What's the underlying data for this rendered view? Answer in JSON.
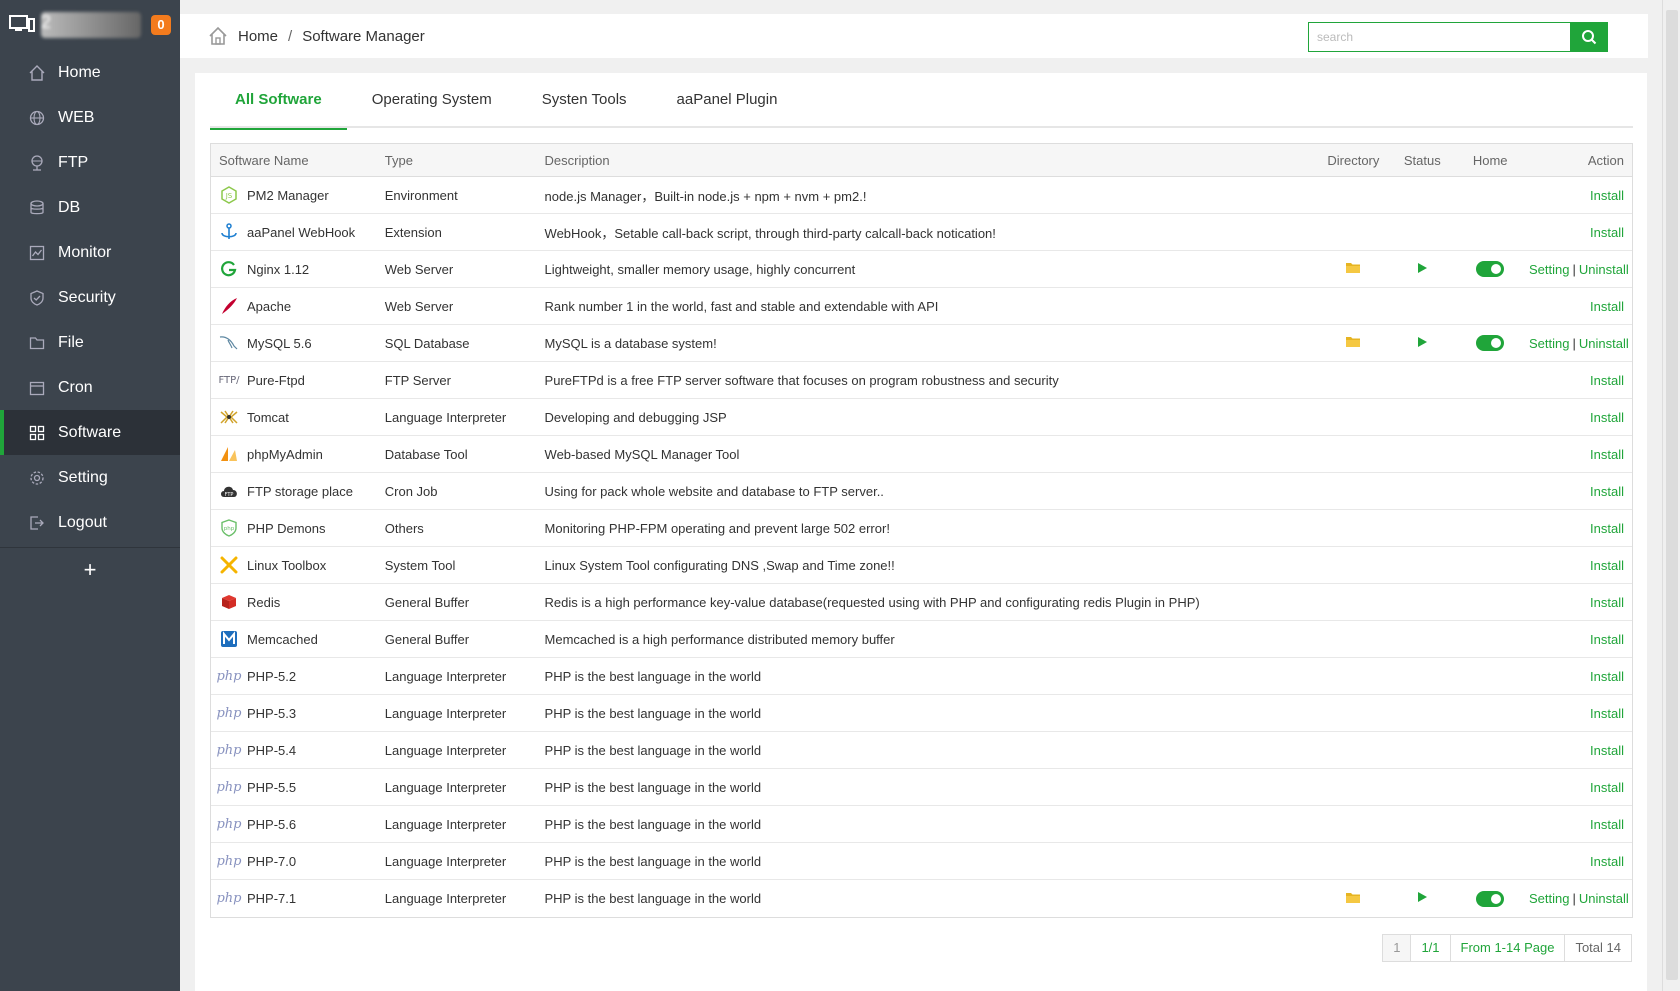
{
  "sidebar": {
    "server_name": "2",
    "notification_count": "0",
    "items": [
      {
        "label": "Home",
        "icon": "home-icon"
      },
      {
        "label": "WEB",
        "icon": "globe-icon"
      },
      {
        "label": "FTP",
        "icon": "ftp-icon"
      },
      {
        "label": "DB",
        "icon": "database-icon"
      },
      {
        "label": "Monitor",
        "icon": "monitor-icon"
      },
      {
        "label": "Security",
        "icon": "shield-icon"
      },
      {
        "label": "File",
        "icon": "folder-icon"
      },
      {
        "label": "Cron",
        "icon": "calendar-icon"
      },
      {
        "label": "Software",
        "icon": "grid-icon",
        "active": true
      },
      {
        "label": "Setting",
        "icon": "gear-icon"
      },
      {
        "label": "Logout",
        "icon": "logout-icon"
      }
    ],
    "add_label": "+"
  },
  "header": {
    "breadcrumb_home": "Home",
    "breadcrumb_sep": "/",
    "breadcrumb_current": "Software Manager",
    "search_placeholder": "search"
  },
  "tabs": [
    "All Software",
    "Operating System",
    "Systen Tools",
    "aaPanel Plugin"
  ],
  "table": {
    "headers": {
      "name": "Software Name",
      "type": "Type",
      "desc": "Description",
      "dir": "Directory",
      "status": "Status",
      "home": "Home",
      "action": "Action"
    },
    "rows": [
      {
        "name": "PM2 Manager",
        "type": "Environment",
        "desc": "node.js Manager，Built-in node.js + npm + nvm + pm2.!",
        "installed": false,
        "icon": "nodejs-icon"
      },
      {
        "name": "aaPanel WebHook",
        "type": "Extension",
        "desc": "WebHook，Setable call-back script, through third-party calcall-back notication!",
        "installed": false,
        "icon": "anchor-icon"
      },
      {
        "name": "Nginx 1.12",
        "type": "Web Server",
        "desc": "Lightweight, smaller memory usage, highly concurrent",
        "installed": true,
        "icon": "nginx-icon"
      },
      {
        "name": "Apache",
        "type": "Web Server",
        "desc": "Rank number 1 in the world, fast and stable and extendable with API",
        "installed": false,
        "icon": "apache-feather-icon"
      },
      {
        "name": "MySQL 5.6",
        "type": "SQL Database",
        "desc": "MySQL is a database system!",
        "installed": true,
        "icon": "mysql-dolphin-icon"
      },
      {
        "name": "Pure-Ftpd",
        "type": "FTP Server",
        "desc": "PureFTPd is a free FTP server software that focuses on program robustness and security",
        "installed": false,
        "icon": "ftp-text-icon"
      },
      {
        "name": "Tomcat",
        "type": "Language Interpreter",
        "desc": "Developing and debugging JSP",
        "installed": false,
        "icon": "tomcat-icon"
      },
      {
        "name": "phpMyAdmin",
        "type": "Database Tool",
        "desc": "Web-based MySQL Manager Tool",
        "installed": false,
        "icon": "phpmyadmin-sail-icon"
      },
      {
        "name": "FTP storage place",
        "type": "Cron Job",
        "desc": "Using for pack whole website and database to FTP server..",
        "installed": false,
        "icon": "cloud-ftp-icon"
      },
      {
        "name": "PHP Demons",
        "type": "Others",
        "desc": "Monitoring PHP-FPM operating and prevent large 502 error!",
        "installed": false,
        "icon": "php-shield-icon"
      },
      {
        "name": "Linux Toolbox",
        "type": "System Tool",
        "desc": "Linux System Tool configurating DNS ,Swap and Time zone!!",
        "installed": false,
        "icon": "tools-icon"
      },
      {
        "name": "Redis",
        "type": "General Buffer",
        "desc": "Redis is a high performance key-value database(requested using with PHP and configurating redis Plugin in PHP)",
        "installed": false,
        "icon": "redis-cube-icon"
      },
      {
        "name": "Memcached",
        "type": "General Buffer",
        "desc": "Memcached is a high performance distributed memory buffer",
        "installed": false,
        "icon": "memcached-m-icon"
      },
      {
        "name": "PHP-5.2",
        "type": "Language Interpreter",
        "desc": "PHP is the best language in the world",
        "installed": false,
        "icon": "php-logo-icon"
      },
      {
        "name": "PHP-5.3",
        "type": "Language Interpreter",
        "desc": "PHP is the best language in the world",
        "installed": false,
        "icon": "php-logo-icon"
      },
      {
        "name": "PHP-5.4",
        "type": "Language Interpreter",
        "desc": "PHP is the best language in the world",
        "installed": false,
        "icon": "php-logo-icon"
      },
      {
        "name": "PHP-5.5",
        "type": "Language Interpreter",
        "desc": "PHP is the best language in the world",
        "installed": false,
        "icon": "php-logo-icon"
      },
      {
        "name": "PHP-5.6",
        "type": "Language Interpreter",
        "desc": "PHP is the best language in the world",
        "installed": false,
        "icon": "php-logo-icon"
      },
      {
        "name": "PHP-7.0",
        "type": "Language Interpreter",
        "desc": "PHP is the best language in the world",
        "installed": false,
        "icon": "php-logo-icon"
      },
      {
        "name": "PHP-7.1",
        "type": "Language Interpreter",
        "desc": "PHP is the best language in the world",
        "installed": true,
        "icon": "php-logo-icon"
      }
    ],
    "labels": {
      "install": "Install",
      "setting": "Setting",
      "uninstall": "Uninstall",
      "sep": "|",
      "php": "php"
    }
  },
  "pager": {
    "current": "1",
    "pages": "1/1",
    "range": "From 1-14 Page",
    "total": "Total 14"
  },
  "colors": {
    "accent": "#20a53a",
    "sidebar": "#3c444d",
    "folder": "#e6b422"
  }
}
